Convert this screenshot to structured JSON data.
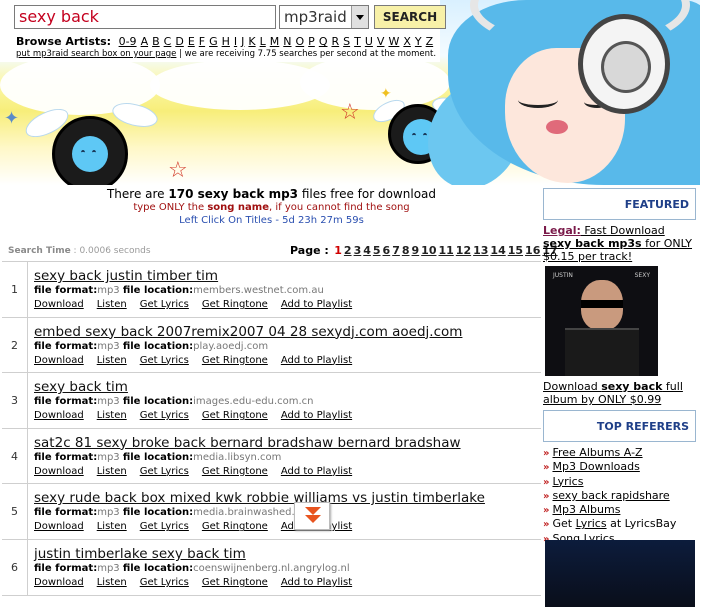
{
  "search": {
    "query": "sexy back",
    "source": "mp3raid",
    "button": "SEARCH"
  },
  "browse": {
    "label": "Browse Artists:",
    "letters": [
      "0-9",
      "A",
      "B",
      "C",
      "D",
      "E",
      "F",
      "G",
      "H",
      "I",
      "J",
      "K",
      "L",
      "M",
      "N",
      "O",
      "P",
      "Q",
      "R",
      "S",
      "T",
      "U",
      "V",
      "W",
      "X",
      "Y",
      "Z"
    ]
  },
  "info": {
    "link": "put mp3raid search box on your page",
    "stat": " | we are receiving 7.75 searches per second at the moment."
  },
  "summary": {
    "pre": "There are ",
    "bold": "170 sexy back mp3",
    "post": " files free for download",
    "hint_pre": "type ONLY the ",
    "hint_bold": "song name",
    "hint_post": ", if you cannot find the song",
    "timer": "Left Click On Titles - 5d 23h 27m 59s"
  },
  "search_time": {
    "label": "Search Time",
    "value": " : 0.0006 seconds"
  },
  "pages": {
    "label": "Page :",
    "items": [
      "1",
      "2",
      "3",
      "4",
      "5",
      "6",
      "7",
      "8",
      "9",
      "10",
      "11",
      "12",
      "13",
      "14",
      "15",
      "16",
      "17"
    ]
  },
  "labels": {
    "file_format": "file format:",
    "file_location": "file location:",
    "download": "Download",
    "listen": "Listen",
    "get_lyrics": "Get Lyrics",
    "get_ringtone": "Get Ringtone",
    "add_to_playlist": "Add to Playlist"
  },
  "results": [
    {
      "num": "1",
      "title": "sexy back justin timber tim",
      "format": "mp3",
      "location": "members.westnet.com.au"
    },
    {
      "num": "2",
      "title": "embed sexy back 2007remix2007 04 28 sexydj.com aoedj.com",
      "format": "mp3",
      "location": "play.aoedj.com"
    },
    {
      "num": "3",
      "title": "sexy back tim",
      "format": "mp3",
      "location": "images.edu-edu.com.cn"
    },
    {
      "num": "4",
      "title": "sat2c 81 sexy broke back bernard bradshaw bernard bradshaw",
      "format": "mp3",
      "location": "media.libsyn.com"
    },
    {
      "num": "5",
      "title": "sexy rude back box mixed kwk robbie williams vs justin timberlake",
      "format": "mp3",
      "location": "media.brainwashed.com"
    },
    {
      "num": "6",
      "title": "justin timberlake sexy back tim",
      "format": "mp3",
      "location": "coenswijnenberg.nl.angrylog.nl"
    }
  ],
  "sidebar": {
    "featured": "FEATURED",
    "legal_label": "Legal:",
    "legal_text": " Fast Download",
    "legal_bold": "sexy back mp3s",
    "legal_rest": " for ONLY $0.15 per track!",
    "album_pre": "Download ",
    "album_bold": "sexy back",
    "album_post": " full album by ONLY $0.99",
    "album_cover_left": "JUSTIN",
    "album_cover_right": "SEXY",
    "referers_head": "TOP REFERERS",
    "referers": [
      "Free Albums A-Z",
      "Mp3 Downloads",
      "Lyrics",
      "sexy back rapidshare",
      "Mp3 Albums"
    ],
    "lyricsbay_pre": "Get ",
    "lyricsbay_link": "Lyrics",
    "lyricsbay_post": " at LyricsBay",
    "song_lyrics": "Song Lyrics"
  }
}
